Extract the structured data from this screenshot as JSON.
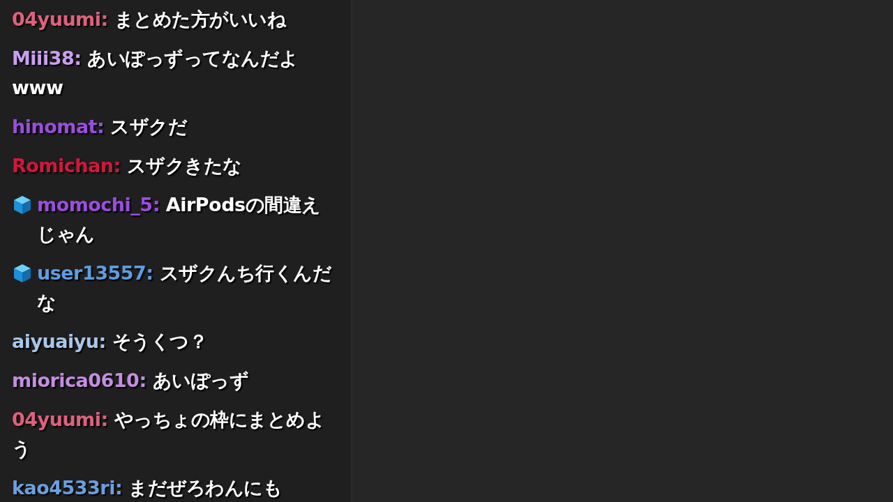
{
  "chat": {
    "messages": [
      {
        "user": "04yuumi:",
        "color": "#e0607e",
        "badge": false,
        "text": "まとめた方がいいね"
      },
      {
        "user": "Miii38:",
        "color": "#c9a0f0",
        "badge": false,
        "text": "あいぽっずってなんだよwww"
      },
      {
        "user": "hinomat:",
        "color": "#9b4de0",
        "badge": false,
        "text": "スザクだ"
      },
      {
        "user": "Romichan:",
        "color": "#d4163c",
        "badge": false,
        "text": "スザクきたな"
      },
      {
        "user": "momochi_5:",
        "color": "#9b4de0",
        "badge": true,
        "text": "AirPodsの間違えじゃん"
      },
      {
        "user": "user13557:",
        "color": "#5e9de0",
        "badge": true,
        "text": "スザクんち行くんだな"
      },
      {
        "user": "aiyuaiyu:",
        "color": "#a9c6e8",
        "badge": false,
        "text": "そうくつ？"
      },
      {
        "user": "miorica0610:",
        "color": "#c58de0",
        "badge": false,
        "text": "あいぽっず"
      },
      {
        "user": "04yuumi:",
        "color": "#e0607e",
        "badge": false,
        "text": "やっちょの枠にまとめよう"
      },
      {
        "user": "kao4533ri:",
        "color": "#6aa0dc",
        "badge": false,
        "text": "まだぜろわんにも"
      }
    ]
  }
}
